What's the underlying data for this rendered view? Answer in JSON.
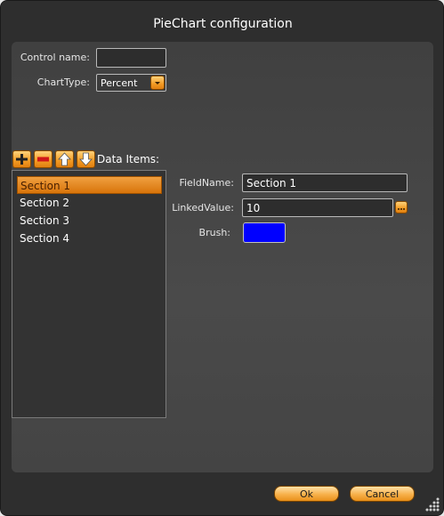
{
  "dialog": {
    "title": "PieChart configuration"
  },
  "config": {
    "control_name_label": "Control name:",
    "control_name_value": "",
    "chart_type_label": "ChartType:",
    "chart_type_value": "Percent"
  },
  "toolbar": {
    "add_icon": "plus-icon",
    "remove_icon": "minus-icon",
    "up_icon": "arrow-up-icon",
    "down_icon": "arrow-down-icon",
    "data_items_label": "Data Items:"
  },
  "items": [
    {
      "label": "Section 1"
    },
    {
      "label": "Section 2"
    },
    {
      "label": "Section 3"
    },
    {
      "label": "Section 4"
    }
  ],
  "details": {
    "field_name_label": "FieldName:",
    "field_name_value": "Section 1",
    "linked_value_label": "LinkedValue:",
    "linked_value_value": "10",
    "brush_label": "Brush:",
    "brush_color": "#0000ff"
  },
  "footer": {
    "ok_label": "Ok",
    "cancel_label": "Cancel"
  },
  "colors": {
    "accent": "#f29b24",
    "background": "#2e2e2e",
    "panel": "#444444"
  }
}
